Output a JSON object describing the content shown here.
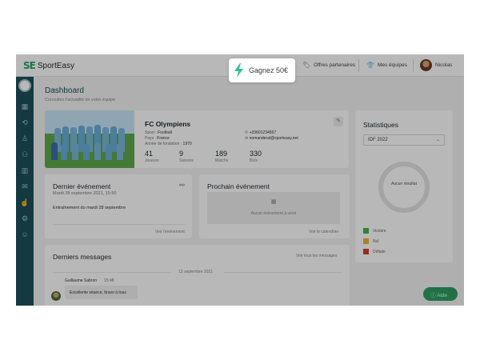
{
  "topbar": {
    "logo_mark": "SE",
    "logo_text": "SportEasy",
    "links": [
      {
        "label": "Offres partenaires",
        "icon": "tag-icon"
      },
      {
        "label": "Mes équipes",
        "icon": "shirt-icon"
      }
    ],
    "user_name": "Nicolas"
  },
  "promo": {
    "label": "Gagnez 50€",
    "icon": "lightning-bolt-icon",
    "color": "#2fc58c"
  },
  "sidebar": {
    "items": [
      "team-crest-icon",
      "calendar-icon",
      "sync-icon",
      "lineup-icon",
      "people-icon",
      "stats-icon",
      "mail-icon",
      "hand-icon",
      "settings-icon",
      "avatar-icon"
    ]
  },
  "page": {
    "title": "Dashboard",
    "subtitle": "Consultez l'actualité de votre équipe"
  },
  "team": {
    "name": "FC Olympiens",
    "sport_label": "Sport :",
    "sport": "Football",
    "country_label": "Pays :",
    "country": "France",
    "founded_label": "Année de fondation :",
    "founded": "1970",
    "phone": "+33601234567",
    "email": "nomanderal@sporteasy.net",
    "stats": [
      {
        "value": "41",
        "label": "Joueurs"
      },
      {
        "value": "9",
        "label": "Saisons"
      },
      {
        "value": "189",
        "label": "Matchs"
      },
      {
        "value": "330",
        "label": "Buts"
      }
    ]
  },
  "last_event": {
    "title": "Dernier événement",
    "date": "Mardi 28 septembre 2021, 15:50",
    "name": "Entraînement du mardi 28 septembre",
    "link": "Voir l'événement"
  },
  "next_event": {
    "title": "Prochain événement",
    "empty": "Aucun événement à venir",
    "link": "Voir le calendrier"
  },
  "messages": {
    "title": "Derniers messages",
    "link": "Voir tous les messages",
    "date": "13 septembre 2021",
    "author": "Guillaume Sabron",
    "time": "15:48",
    "text": "Excellente séance, bravo à tous"
  },
  "stats_panel": {
    "title": "Statistiques",
    "season": "IDF 2022",
    "empty": "Aucun résultat",
    "legend": [
      {
        "label": "Victoire",
        "color": "#3db34a"
      },
      {
        "label": "Nul",
        "color": "#e8b42b"
      },
      {
        "label": "Défaite",
        "color": "#d93a2b"
      }
    ]
  },
  "help": {
    "label": "Aide"
  }
}
